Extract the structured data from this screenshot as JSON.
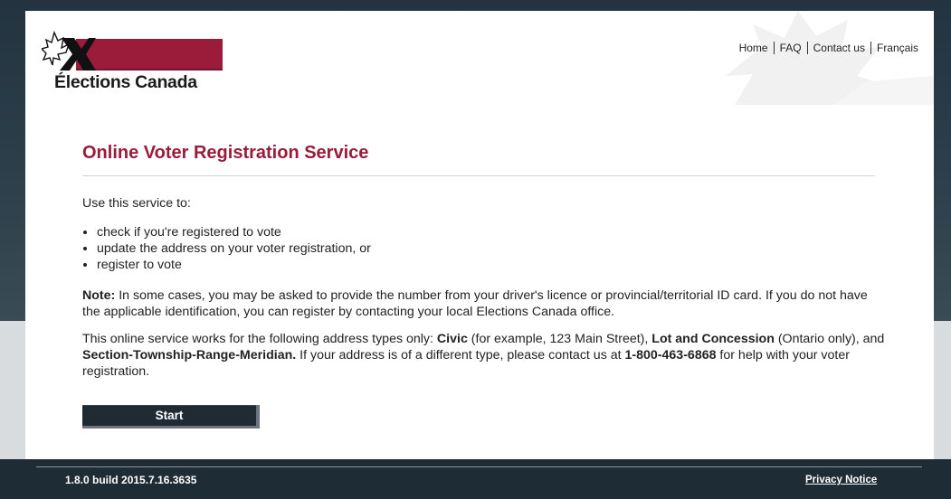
{
  "header": {
    "logo_text": "Élections Canada",
    "nav": [
      "Home",
      "FAQ",
      "Contact us",
      "Français"
    ]
  },
  "main": {
    "title": "Online Voter Registration Service",
    "intro": "Use this service to:",
    "uses": [
      "check if you're registered to vote",
      "update the address on your voter registration, or",
      "register to vote"
    ],
    "note_label": "Note:",
    "note_text": " In some cases, you may be asked to provide the number from your driver's licence or provincial/territorial ID card. If you do not have the applicable identification, you can register by contacting your local Elections Canada office.",
    "addr": {
      "t1": "This online service works for the following address types only: ",
      "b1": "Civic",
      "t2": " (for example, 123 Main Street), ",
      "b2": "Lot and Concession",
      "t3": " (Ontario only), and ",
      "b3": "Section-Township-Range-Meridian.",
      "t4": " If your address is of a different type, please contact us at ",
      "b4": "1-800-463-6868",
      "t5": " for help with your voter registration."
    },
    "start_label": "Start"
  },
  "footer": {
    "version": "1.8.0 build 2015.7.16.3635",
    "privacy": "Privacy Notice"
  },
  "colors": {
    "brand_red": "#9b1b3a",
    "button_bg": "#1f2a33",
    "footer_bg": "#1e2c35"
  },
  "icons": {
    "logo_mark": "maple-leaf-x-icon",
    "watermark": "maple-leaf-watermark"
  }
}
